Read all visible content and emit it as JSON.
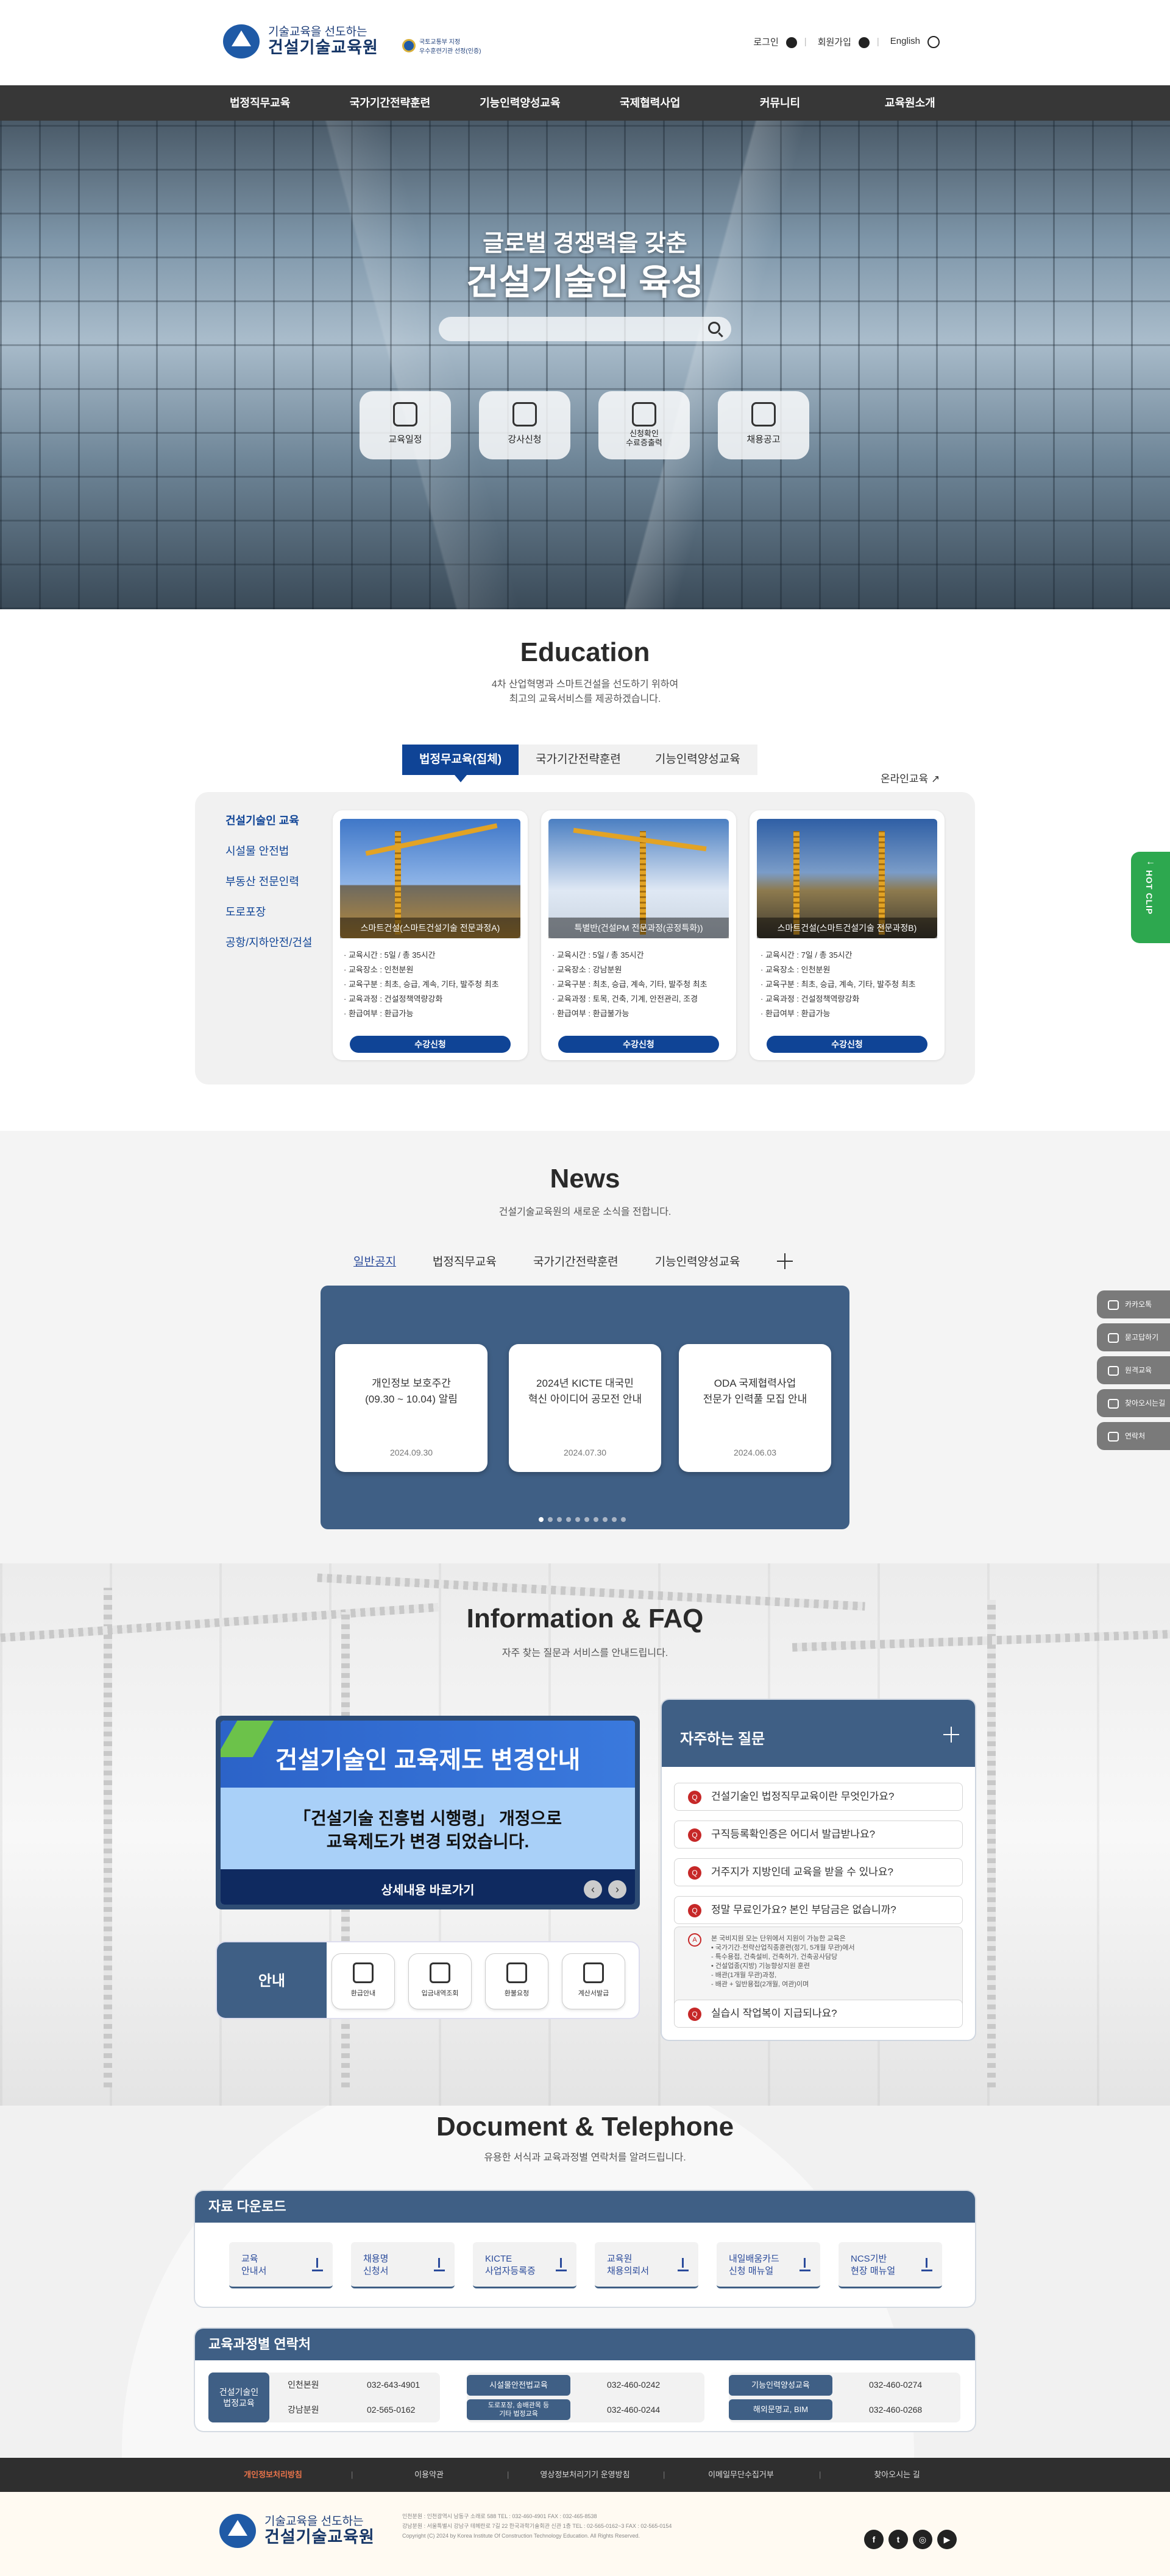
{
  "header": {
    "logo_small": "기술교육을 선도하는",
    "logo_big": "건설기술교육원",
    "cert_line1": "국토교통부 지정",
    "cert_line2": "우수훈련기관 선정(인증)",
    "login": "로그인",
    "join": "회원가입",
    "english": "English"
  },
  "gnb": [
    "법정직무교육",
    "국가기간전략훈련",
    "기능인력양성교육",
    "국제협력사업",
    "커뮤니티",
    "교육원소개"
  ],
  "hero": {
    "line1": "글로벌 경쟁력을 갖춘",
    "line2": "건설기술인 육성",
    "search_placeholder": "",
    "quick": [
      {
        "label": "교육일정",
        "icon": "calendar-icon"
      },
      {
        "label": "강사신청",
        "icon": "lecturer-icon"
      },
      {
        "label": "신청확인\n수료증출력",
        "icon": "certificate-icon"
      },
      {
        "label": "채용공고",
        "icon": "recruit-icon"
      }
    ]
  },
  "education": {
    "title": "Education",
    "sub1": "4차 산업혁명과 스마트건설을 선도하기 위하여",
    "sub2": "최고의 교육서비스를 제공하겠습니다.",
    "tabs": [
      "법정무교육(집체)",
      "국가기간전략훈련",
      "기능인력양성교육"
    ],
    "online": "온라인교육",
    "side": [
      "건설기술인 교육",
      "시설물 안전법",
      "부동산 전문인력",
      "도로포장",
      "공항/지하안전/건설"
    ],
    "cards": [
      {
        "caption": "스마트건설(스마트건설기술 전문과정A)",
        "lines": [
          "교육시간 : 5일 / 총 35시간",
          "교육장소 : 인천분원",
          "교육구분 : 최초, 승급, 계속, 기타, 발주청 최초",
          "교육과정 : 건설정책역량강화",
          "환급여부 : 환급가능"
        ],
        "button": "수강신청"
      },
      {
        "caption": "특별반(건설PM 전문과정(공정특화))",
        "lines": [
          "교육시간 : 5일 / 총 35시간",
          "교육장소 : 강남분원",
          "교육구분 : 최초, 승급, 계속, 기타, 발주청 최초",
          "교육과정 : 토목, 건축, 기계, 안전관리, 조경",
          "환급여부 : 환급불가능"
        ],
        "button": "수강신청"
      },
      {
        "caption": "스마트건설(스마트건설기술 전문과정B)",
        "lines": [
          "교육시간 : 7일 / 총 35시간",
          "교육장소 : 인천분원",
          "교육구분 : 최초, 승급, 계속, 기타, 발주청 최초",
          "교육과정 : 건설정책역량강화",
          "환급여부 : 환급가능"
        ],
        "button": "수강신청"
      }
    ],
    "hot_clip": "HOT CLIP"
  },
  "news": {
    "title": "News",
    "sub": "건설기술교육원의 새로운 소식을 전합니다.",
    "tabs": [
      "일반공지",
      "법정직무교육",
      "국가기간전략훈련",
      "기능인력양성교육"
    ],
    "cards": [
      {
        "title": "개인정보 보호주간\n(09.30 ~ 10.04) 알림",
        "date": "2024.09.30"
      },
      {
        "title": "2024년 KICTE 대국민\n혁신 아이디어 공모전 안내",
        "date": "2024.07.30"
      },
      {
        "title": "ODA 국제협력사업\n전문가 인력풀 모집 안내",
        "date": "2024.06.03"
      }
    ]
  },
  "side_menu": [
    {
      "label": "카카오톡",
      "icon": "kakao-icon"
    },
    {
      "label": "묻고답하기",
      "icon": "qna-icon"
    },
    {
      "label": "원격교육",
      "icon": "monitor-icon"
    },
    {
      "label": "찾아오시는길",
      "icon": "location-icon"
    },
    {
      "label": "연락처",
      "icon": "phone-icon"
    }
  ],
  "info": {
    "title": "Information & FAQ",
    "sub": "자주 찾는 질문과 서비스를 안내드립니다.",
    "banner_title": "건설기술인 교육제도 변경안내",
    "banner_line1": "「건설기술 진흥법 시행령」 개정으로",
    "banner_line2": "교육제도가 변경 되었습니다.",
    "banner_link": "상세내용 바로가기",
    "guide_label": "안내",
    "guide_items": [
      "환급안내",
      "입금내역조회",
      "환불요청",
      "계산서발급"
    ],
    "faq_title": "자주하는 질문",
    "faq": [
      "건설기술인 법정직무교육이란 무엇인가요?",
      "구직등록확인증은 어디서 발급받나요?",
      "거주지가 지방인데 교육을 받을 수 있나요?",
      "정말 무료인가요? 본인 부담금은 없습니까?",
      "실습시 작업복이 지급되나요?"
    ],
    "faq_answer": [
      "본 국비지원 모는 단위에서 지원이 가능한 교육은",
      "• 국가기간·전략산업직종훈련(정기, 5개월 무관)에서",
      "  - 특수용접, 건축설비, 건축허가, 건축공사담당",
      "• 건설업종(지방) 기능향상지원 훈련",
      "  - 배관(1개월 무관)과정,",
      "  - 배관 + 일반용접(2개월, 여관)이며"
    ]
  },
  "document": {
    "title": "Document & Telephone",
    "sub": "유용한 서식과 교육과정별 연락처를 알려드립니다.",
    "download_title": "자료 다운로드",
    "downloads": [
      "교육\n안내서",
      "채용명\n신청서",
      "KICTE\n사업자등록증",
      "교육원\n채용의뢰서",
      "내일배움카드\n신청 매뉴얼",
      "NCS기반\n현장 매뉴얼"
    ],
    "contact_title": "교육과정별 연락처",
    "contacts": {
      "g1_label": "건설기술인\n법정교육",
      "g1_rows": [
        [
          "인천본원",
          "032-643-4901"
        ],
        [
          "강남분원",
          "02-565-0162"
        ]
      ],
      "g2_rows": [
        [
          "시설물안전법교육",
          "032-460-0242"
        ],
        [
          "도로포장, 송배관목 등\n기타 법정교육",
          "032-460-0244"
        ]
      ],
      "g3_rows": [
        [
          "기능인력양성교육",
          "032-460-0274"
        ],
        [
          "해외문명교, BIM",
          "032-460-0268"
        ]
      ]
    }
  },
  "footer": {
    "links": [
      "개인정보처리방침",
      "이용약관",
      "영상정보처리기기 운영방침",
      "이메일무단수집거부",
      "찾아오시는 길"
    ],
    "info1": "인천분원 : 인천광역시 남동구 소래로 588    TEL : 032-460-4901    FAX : 032-465-8538",
    "info2": "강남분원 : 서울특별시 강남구 테헤란로 7길 22 한국과학기술회관 신관 1층    TEL : 02-565-0162~3    FAX : 02-565-0154",
    "copyright": "Copyright (C) 2024 by Korea Institute Of Construction Technology Education. All Rights Reserved.",
    "sns": [
      {
        "icon": "facebook-icon",
        "glyph": "f"
      },
      {
        "icon": "twitter-icon",
        "glyph": "t"
      },
      {
        "icon": "instagram-icon",
        "glyph": "◎"
      },
      {
        "icon": "youtube-icon",
        "glyph": "▶"
      }
    ]
  }
}
